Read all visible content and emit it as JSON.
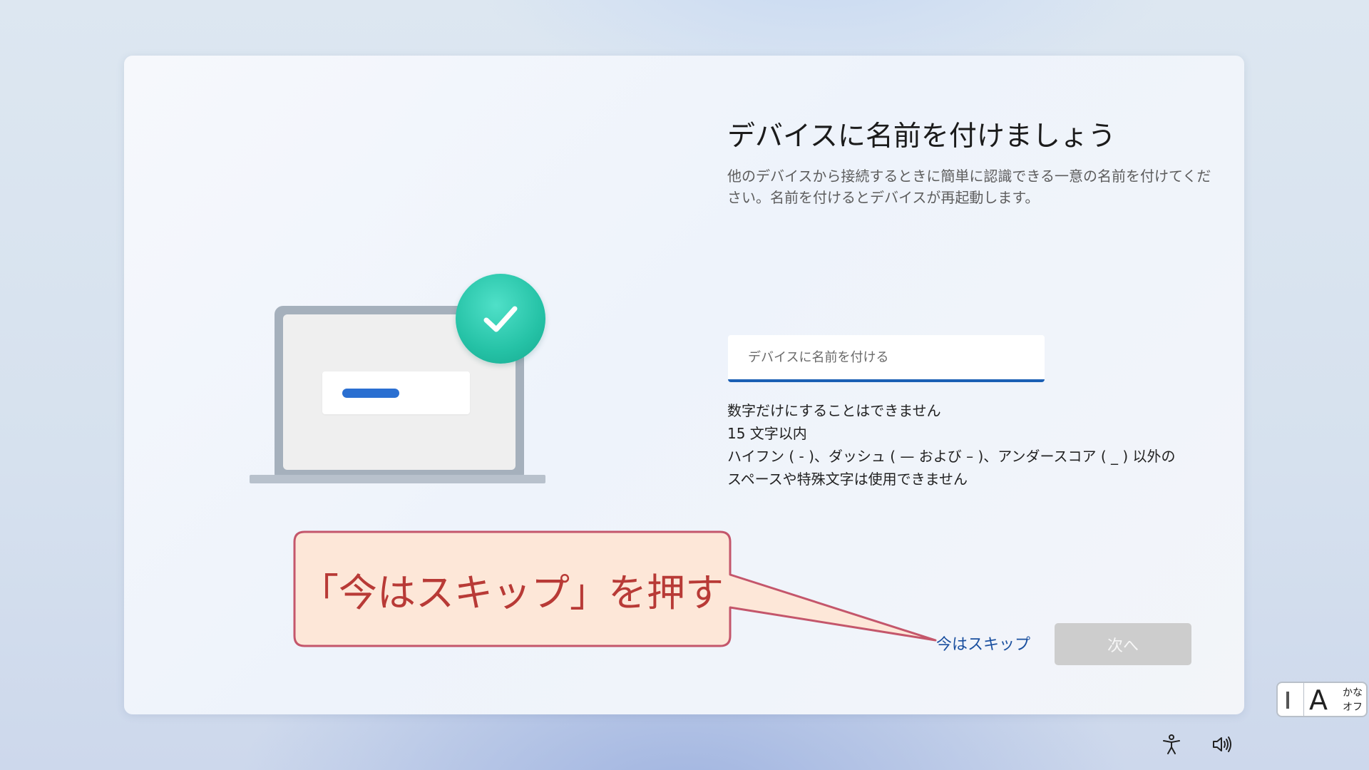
{
  "dialog": {
    "title": "デバイスに名前を付けましょう",
    "description": "他のデバイスから接続するときに簡単に認識できる一意の名前を付けてください。名前を付けるとデバイスが再起動します。",
    "input": {
      "placeholder": "デバイスに名前を付ける",
      "value": ""
    },
    "rules": [
      "数字だけにすることはできません",
      "15 文字以内",
      "ハイフン ( - )、ダッシュ ( — および – )、アンダースコア ( _ ) 以外の",
      "スペースや特殊文字は使用できません"
    ],
    "skip_label": "今はスキップ",
    "next_label": "次へ"
  },
  "annotation": {
    "text": "「今はスキップ」を押す",
    "fill_color": "#fde7d8",
    "border_color": "#c4566b",
    "text_color": "#b83a36"
  },
  "tray": {
    "ime_mode": "A",
    "ime_kana_line1": "かな",
    "ime_kana_line2": "オフ",
    "icons": [
      "accessibility-icon",
      "volume-icon"
    ]
  },
  "colors": {
    "accent": "#1a5fb4",
    "check_circle": "#25c2a6",
    "next_button_disabled": "#cdcdcd"
  }
}
